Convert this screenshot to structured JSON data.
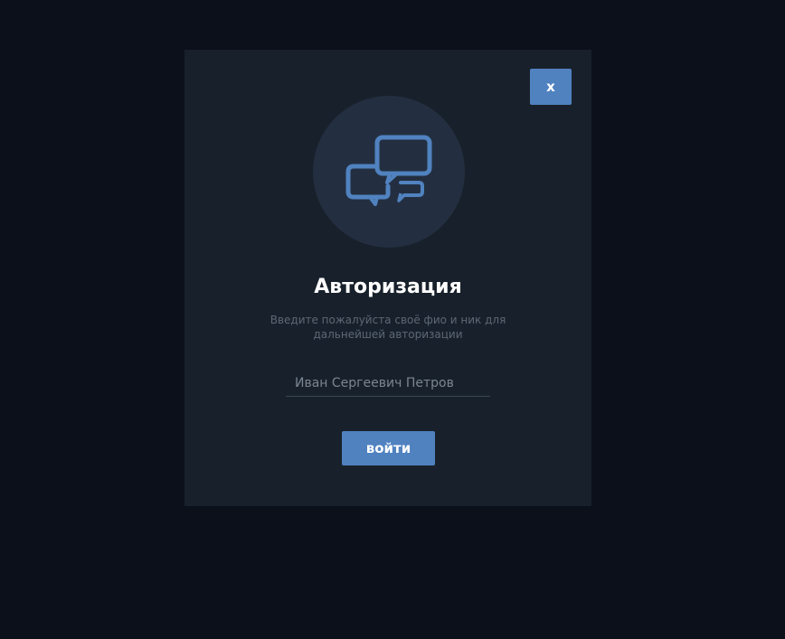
{
  "modal": {
    "close_label": "x",
    "icon": "chat-bubbles-icon",
    "title": "Авторизация",
    "subtitle": "Введите пожалуйста своё фио и ник для дальнейшей авторизации",
    "name_input": {
      "value": "Иван Сергеевич Петров",
      "placeholder": ""
    },
    "login_label": "войти"
  },
  "colors": {
    "background": "#0b101b",
    "modal": "#18212b",
    "accent": "#5082c0",
    "icon_circle": "#232f40"
  }
}
